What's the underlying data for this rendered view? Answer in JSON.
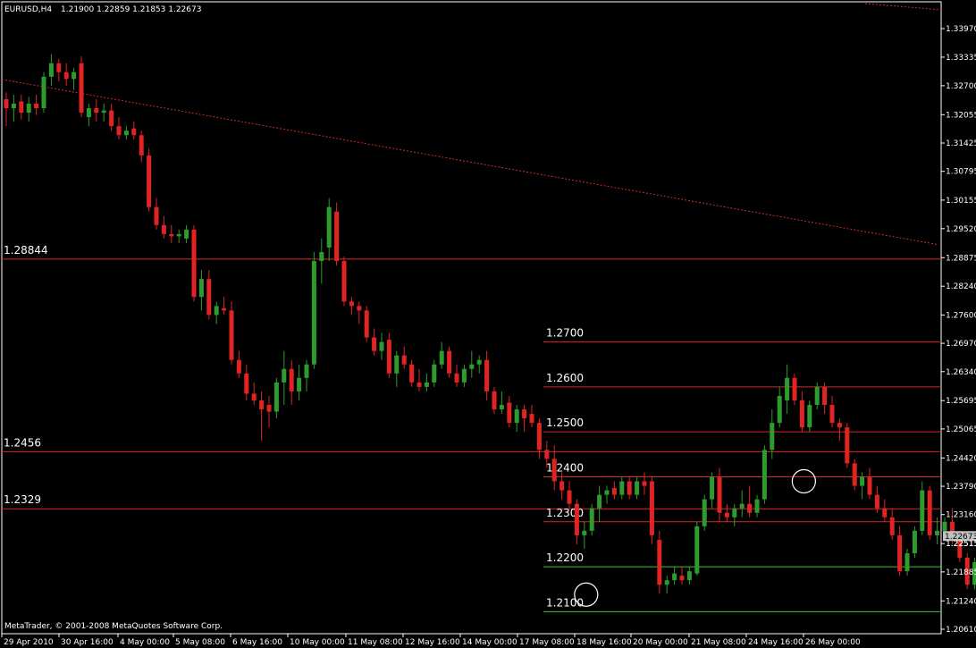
{
  "header": {
    "symbol": "EURUSD,H4",
    "ohlc": "1.21900 1.22859 1.21853 1.22673"
  },
  "footer": {
    "copyright": "MetaTrader, © 2001-2008 MetaQuotes Software Corp."
  },
  "colors": {
    "background": "#000000",
    "bull": "#2e9b2e",
    "bear": "#e02424",
    "grid_frame": "#ffffff",
    "level_red": "#d62a2a",
    "level_green": "#3cc43c",
    "trendline": "#d62a2a",
    "current_price_bg": "#c0c0c0"
  },
  "chart_data": {
    "type": "candlestick",
    "symbol": "EURUSD",
    "timeframe": "H4",
    "y_ticks": [
      "1.33970",
      "1.33335",
      "1.32700",
      "1.32055",
      "1.31425",
      "1.30795",
      "1.30155",
      "1.29520",
      "1.28875",
      "1.28240",
      "1.27600",
      "1.26970",
      "1.26340",
      "1.25695",
      "1.25065",
      "1.24420",
      "1.23790",
      "1.23160",
      "1.22515",
      "1.21885",
      "1.21240",
      "1.20610"
    ],
    "ylim": [
      1.2061,
      1.3397
    ],
    "x_ticks": [
      "29 Apr 2010",
      "30 Apr 16:00",
      "4 May 00:00",
      "5 May 08:00",
      "6 May 16:00",
      "10 May 00:00",
      "11 May 08:00",
      "12 May 16:00",
      "14 May 00:00",
      "17 May 08:00",
      "18 May 16:00",
      "20 May 00:00",
      "21 May 08:00",
      "24 May 16:00",
      "26 May 00:00"
    ],
    "current_price": "1.22673",
    "extra_price_label": "1.22515",
    "levels": [
      {
        "label": "1.28844",
        "price": 1.28844,
        "color": "red",
        "label_side": "left"
      },
      {
        "label": "1.2456",
        "price": 1.2456,
        "color": "red",
        "label_side": "left"
      },
      {
        "label": "1.2329",
        "price": 1.2329,
        "color": "red",
        "label_side": "left"
      },
      {
        "label": "1.2700",
        "price": 1.27,
        "color": "red",
        "label_side": "middle"
      },
      {
        "label": "1.2600",
        "price": 1.26,
        "color": "red",
        "label_side": "middle"
      },
      {
        "label": "1.2500",
        "price": 1.25,
        "color": "red",
        "label_side": "middle"
      },
      {
        "label": "1.2400",
        "price": 1.24,
        "color": "red",
        "label_side": "middle"
      },
      {
        "label": "1.2300",
        "price": 1.23,
        "color": "red",
        "label_side": "middle"
      },
      {
        "label": "1.2200",
        "price": 1.22,
        "color": "green",
        "label_side": "middle"
      },
      {
        "label": "1.2100",
        "price": 1.21,
        "color": "green",
        "label_side": "middle"
      }
    ],
    "trendline": {
      "from": {
        "bar": 0,
        "price": 1.3284
      },
      "to": {
        "bar": 124,
        "price": 1.2917
      }
    },
    "markers": [
      {
        "bar": 77,
        "price": 1.2138,
        "type": "circle"
      },
      {
        "bar": 106,
        "price": 1.239,
        "type": "circle"
      }
    ],
    "candles": [
      [
        1.324,
        1.3255,
        1.318,
        1.322
      ],
      [
        1.322,
        1.325,
        1.319,
        1.323
      ],
      [
        1.3235,
        1.325,
        1.3195,
        1.321
      ],
      [
        1.321,
        1.3245,
        1.319,
        1.323
      ],
      [
        1.323,
        1.325,
        1.3205,
        1.322
      ],
      [
        1.322,
        1.33,
        1.321,
        1.329
      ],
      [
        1.329,
        1.334,
        1.327,
        1.332
      ],
      [
        1.332,
        1.333,
        1.328,
        1.33
      ],
      [
        1.33,
        1.332,
        1.327,
        1.3285
      ],
      [
        1.3285,
        1.331,
        1.326,
        1.33
      ],
      [
        1.332,
        1.3335,
        1.32,
        1.321
      ],
      [
        1.32,
        1.323,
        1.318,
        1.322
      ],
      [
        1.322,
        1.324,
        1.319,
        1.321
      ],
      [
        1.321,
        1.323,
        1.319,
        1.3215
      ],
      [
        1.3215,
        1.323,
        1.317,
        1.318
      ],
      [
        1.318,
        1.32,
        1.315,
        1.316
      ],
      [
        1.316,
        1.318,
        1.315,
        1.317
      ],
      [
        1.3175,
        1.319,
        1.315,
        1.316
      ],
      [
        1.316,
        1.317,
        1.31,
        1.3115
      ],
      [
        1.3115,
        1.313,
        1.299,
        1.3
      ],
      [
        1.3,
        1.302,
        1.295,
        1.296
      ],
      [
        1.296,
        1.298,
        1.293,
        1.294
      ],
      [
        1.294,
        1.296,
        1.292,
        1.2935
      ],
      [
        1.2935,
        1.295,
        1.292,
        1.294
      ],
      [
        1.293,
        1.296,
        1.292,
        1.295
      ],
      [
        1.295,
        1.296,
        1.279,
        1.28
      ],
      [
        1.28,
        1.286,
        1.277,
        1.284
      ],
      [
        1.284,
        1.286,
        1.275,
        1.276
      ],
      [
        1.276,
        1.279,
        1.274,
        1.278
      ],
      [
        1.2775,
        1.28,
        1.276,
        1.277
      ],
      [
        1.277,
        1.279,
        1.265,
        1.266
      ],
      [
        1.266,
        1.268,
        1.262,
        1.263
      ],
      [
        1.263,
        1.265,
        1.257,
        1.2585
      ],
      [
        1.2585,
        1.261,
        1.256,
        1.257
      ],
      [
        1.257,
        1.259,
        1.248,
        1.255
      ],
      [
        1.256,
        1.258,
        1.251,
        1.2545
      ],
      [
        1.2545,
        1.262,
        1.253,
        1.261
      ],
      [
        1.261,
        1.268,
        1.256,
        1.264
      ],
      [
        1.264,
        1.266,
        1.256,
        1.259
      ],
      [
        1.259,
        1.265,
        1.257,
        1.262
      ],
      [
        1.262,
        1.266,
        1.259,
        1.265
      ],
      [
        1.265,
        1.29,
        1.264,
        1.288
      ],
      [
        1.288,
        1.293,
        1.283,
        1.29
      ],
      [
        1.291,
        1.302,
        1.288,
        1.3
      ],
      [
        1.299,
        1.301,
        1.287,
        1.288
      ],
      [
        1.288,
        1.289,
        1.278,
        1.279
      ],
      [
        1.279,
        1.28,
        1.276,
        1.278
      ],
      [
        1.278,
        1.279,
        1.274,
        1.277
      ],
      [
        1.277,
        1.278,
        1.27,
        1.271
      ],
      [
        1.271,
        1.273,
        1.267,
        1.268
      ],
      [
        1.268,
        1.272,
        1.266,
        1.27
      ],
      [
        1.2705,
        1.272,
        1.262,
        1.263
      ],
      [
        1.263,
        1.268,
        1.26,
        1.267
      ],
      [
        1.267,
        1.269,
        1.264,
        1.265
      ],
      [
        1.265,
        1.266,
        1.26,
        1.261
      ],
      [
        1.261,
        1.264,
        1.259,
        1.26
      ],
      [
        1.26,
        1.263,
        1.259,
        1.261
      ],
      [
        1.261,
        1.266,
        1.26,
        1.265
      ],
      [
        1.265,
        1.27,
        1.264,
        1.268
      ],
      [
        1.268,
        1.269,
        1.262,
        1.263
      ],
      [
        1.263,
        1.265,
        1.26,
        1.261
      ],
      [
        1.261,
        1.265,
        1.26,
        1.264
      ],
      [
        1.264,
        1.268,
        1.262,
        1.265
      ],
      [
        1.265,
        1.267,
        1.263,
        1.266
      ],
      [
        1.266,
        1.268,
        1.257,
        1.259
      ],
      [
        1.259,
        1.26,
        1.254,
        1.255
      ],
      [
        1.255,
        1.259,
        1.254,
        1.256
      ],
      [
        1.2565,
        1.258,
        1.251,
        1.252
      ],
      [
        1.252,
        1.256,
        1.25,
        1.255
      ],
      [
        1.255,
        1.256,
        1.25,
        1.253
      ],
      [
        1.254,
        1.256,
        1.251,
        1.252
      ],
      [
        1.252,
        1.253,
        1.244,
        1.246
      ],
      [
        1.246,
        1.248,
        1.242,
        1.244
      ],
      [
        1.244,
        1.247,
        1.237,
        1.239
      ],
      [
        1.239,
        1.241,
        1.235,
        1.237
      ],
      [
        1.237,
        1.239,
        1.233,
        1.234
      ],
      [
        1.234,
        1.235,
        1.225,
        1.227
      ],
      [
        1.227,
        1.23,
        1.224,
        1.228
      ],
      [
        1.228,
        1.234,
        1.227,
        1.233
      ],
      [
        1.233,
        1.238,
        1.23,
        1.236
      ],
      [
        1.236,
        1.238,
        1.234,
        1.237
      ],
      [
        1.2375,
        1.239,
        1.235,
        1.236
      ],
      [
        1.236,
        1.24,
        1.235,
        1.239
      ],
      [
        1.239,
        1.24,
        1.235,
        1.236
      ],
      [
        1.236,
        1.24,
        1.235,
        1.239
      ],
      [
        1.239,
        1.241,
        1.236,
        1.238
      ],
      [
        1.239,
        1.24,
        1.225,
        1.227
      ],
      [
        1.226,
        1.228,
        1.214,
        1.216
      ],
      [
        1.216,
        1.218,
        1.214,
        1.217
      ],
      [
        1.217,
        1.22,
        1.216,
        1.2185
      ],
      [
        1.218,
        1.22,
        1.216,
        1.217
      ],
      [
        1.217,
        1.22,
        1.216,
        1.219
      ],
      [
        1.2185,
        1.23,
        1.218,
        1.229
      ],
      [
        1.229,
        1.236,
        1.228,
        1.235
      ],
      [
        1.235,
        1.241,
        1.233,
        1.24
      ],
      [
        1.24,
        1.242,
        1.23,
        1.232
      ],
      [
        1.232,
        1.234,
        1.23,
        1.231
      ],
      [
        1.231,
        1.234,
        1.229,
        1.233
      ],
      [
        1.233,
        1.237,
        1.231,
        1.234
      ],
      [
        1.234,
        1.238,
        1.231,
        1.232
      ],
      [
        1.232,
        1.236,
        1.231,
        1.235
      ],
      [
        1.235,
        1.247,
        1.234,
        1.246
      ],
      [
        1.246,
        1.255,
        1.244,
        1.252
      ],
      [
        1.252,
        1.26,
        1.251,
        1.258
      ],
      [
        1.257,
        1.265,
        1.254,
        1.262
      ],
      [
        1.262,
        1.263,
        1.256,
        1.257
      ],
      [
        1.257,
        1.259,
        1.25,
        1.251
      ],
      [
        1.251,
        1.257,
        1.25,
        1.256
      ],
      [
        1.256,
        1.261,
        1.255,
        1.26
      ],
      [
        1.26,
        1.261,
        1.254,
        1.256
      ],
      [
        1.256,
        1.258,
        1.251,
        1.252
      ],
      [
        1.252,
        1.253,
        1.248,
        1.251
      ],
      [
        1.251,
        1.252,
        1.242,
        1.243
      ],
      [
        1.243,
        1.244,
        1.237,
        1.238
      ],
      [
        1.238,
        1.241,
        1.235,
        1.24
      ],
      [
        1.24,
        1.242,
        1.235,
        1.236
      ],
      [
        1.236,
        1.238,
        1.232,
        1.233
      ],
      [
        1.233,
        1.235,
        1.23,
        1.231
      ],
      [
        1.231,
        1.233,
        1.226,
        1.227
      ],
      [
        1.227,
        1.229,
        1.218,
        1.219
      ],
      [
        1.219,
        1.224,
        1.218,
        1.223
      ],
      [
        1.223,
        1.229,
        1.222,
        1.228
      ],
      [
        1.228,
        1.239,
        1.227,
        1.237
      ],
      [
        1.237,
        1.238,
        1.226,
        1.227
      ],
      [
        1.227,
        1.231,
        1.225,
        1.228
      ],
      [
        1.228,
        1.231,
        1.226,
        1.23
      ],
      [
        1.23,
        1.233,
        1.225,
        1.226
      ],
      [
        1.226,
        1.228,
        1.221,
        1.222
      ],
      [
        1.222,
        1.223,
        1.215,
        1.216
      ],
      [
        1.216,
        1.222,
        1.215,
        1.221
      ],
      [
        1.219,
        1.2286,
        1.2185,
        1.2267
      ]
    ]
  }
}
